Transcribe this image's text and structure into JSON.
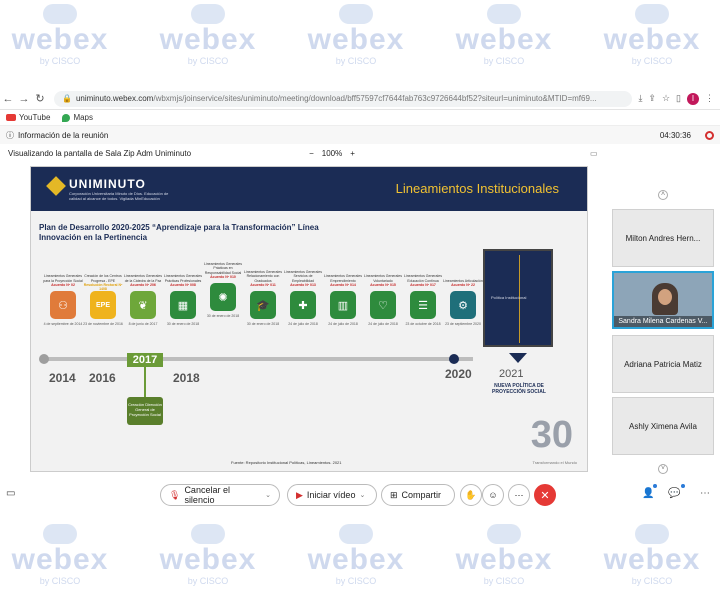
{
  "watermark": {
    "word": "webex",
    "sub": "by CISCO"
  },
  "browser": {
    "url_prefix": "uniminuto.webex.com",
    "url_rest": "/wbxmjs/joinservice/sites/uniminuto/meeting/download/bff57597cf7644fab763c9726644bf52?siteurl=uniminuto&MTID=mf69...",
    "profile_initial": "I"
  },
  "bookmarks": [
    {
      "label": "YouTube"
    },
    {
      "label": "Maps"
    }
  ],
  "meeting": {
    "info_label": "Información de la reunión",
    "timer": "04:30:36",
    "share_label": "Visualizando la pantalla de Sala Zip Adm Uniminuto",
    "zoom_minus": "−",
    "zoom_value": "100%",
    "zoom_plus": "+"
  },
  "slide": {
    "brand": "UNIMINUTO",
    "brand_sub": "Corporación Universitaria Minuto de Dios. Educación de calidad al alcance de todos. Vigilada MinEducación",
    "header_title": "Lineamientos Institucionales",
    "plan_title": "Plan de Desarrollo 2020-2025 “Aprendizaje para la Transformación” Línea Innovación en la Pertinencia",
    "milestones": [
      {
        "label": "Lineamientos Generales para la Proyección Social",
        "agreement": "Acuerdo Nº 02",
        "date": "4 de septiembre de 2014",
        "icon": "people-icon",
        "color": "#e07b3a",
        "glyph": "⚇"
      },
      {
        "label": "Creación de los Centros Progresa - EPE",
        "agreement": "Resolución Rectoral Nº 1408",
        "date": "23 de noviembre de 2016",
        "icon": "epe-icon",
        "color": "#efb31d",
        "glyph": "EPE"
      },
      {
        "label": "Lineamientos Generales de la Cátedra de la Paz",
        "agreement": "Acuerdo Nº 206",
        "date": "8 de junio de 2017",
        "icon": "dove-icon",
        "color": "#6ea73a",
        "glyph": "❦"
      },
      {
        "label": "Lineamientos Generales Prácticas Profesionales",
        "agreement": "Acuerdo Nº 008",
        "date": "30 de enero de 2018",
        "icon": "building-icon",
        "color": "#2e8b3d",
        "glyph": "▦"
      },
      {
        "label": "Lineamientos Generales Prácticas en Responsabilidad Social",
        "agreement": "Acuerdo Nº 010",
        "date": "30 de enero de 2018",
        "icon": "gears-icon",
        "color": "#2e8b3d",
        "glyph": "✺"
      },
      {
        "label": "Lineamientos Generales Relacionamiento con Graduados",
        "agreement": "Acuerdo Nº 011",
        "date": "30 de enero de 2018",
        "icon": "graduate-icon",
        "color": "#2e8b3d",
        "glyph": "🎓"
      },
      {
        "label": "Lineamientos Generales Servicios de Empleabilidad",
        "agreement": "Acuerdo Nº 013",
        "date": "24 de julio de 2018",
        "icon": "team-icon",
        "color": "#2e8b3d",
        "glyph": "✚"
      },
      {
        "label": "Lineamientos Generales Emprendimiento",
        "agreement": "Acuerdo Nº 014",
        "date": "24 de julio de 2018",
        "icon": "chart-icon",
        "color": "#2e8b3d",
        "glyph": "▥"
      },
      {
        "label": "Lineamientos Generales Voluntariado",
        "agreement": "Acuerdo Nº 015",
        "date": "24 de julio de 2018",
        "icon": "heart-hand-icon",
        "color": "#2e8b3d",
        "glyph": "♡"
      },
      {
        "label": "Lineamientos Generales Educación Continua",
        "agreement": "Acuerdo Nº 017",
        "date": "23 de octubre de 2018",
        "icon": "books-icon",
        "color": "#2e8b3d",
        "glyph": "☰"
      },
      {
        "label": "Lineamientos Articulación",
        "agreement": "Acuerdo Nº 22",
        "date": "23 de septiembre 2020",
        "icon": "gear-icon",
        "color": "#1f6f7a",
        "glyph": "⚙"
      }
    ],
    "years": [
      "2014",
      "2016",
      "2017",
      "2018",
      "2020"
    ],
    "creation_box": "Creación Dirección General de Proyección Social",
    "book_title": "Política Institucional",
    "policy_year": "2021",
    "policy_text": "NUEVA POLÍTICA DE PROYECCIÓN SOCIAL",
    "anniversary": "30",
    "anniversary_sub": "Transformando el Mundo",
    "source": "Fuente: Repositorio Institucional Políticas, Lineamientos. 2021"
  },
  "participants": [
    {
      "name": "Milton Andres Hern..."
    },
    {
      "name": "Sandra Milena Cardenas V..."
    },
    {
      "name": "Adriana Patricia Matiz"
    },
    {
      "name": "Ashly Ximena Avila"
    }
  ],
  "controls": {
    "mute_label": "Cancelar el silencio",
    "video_label": "Iniciar vídeo",
    "share_label": "Compartir"
  }
}
